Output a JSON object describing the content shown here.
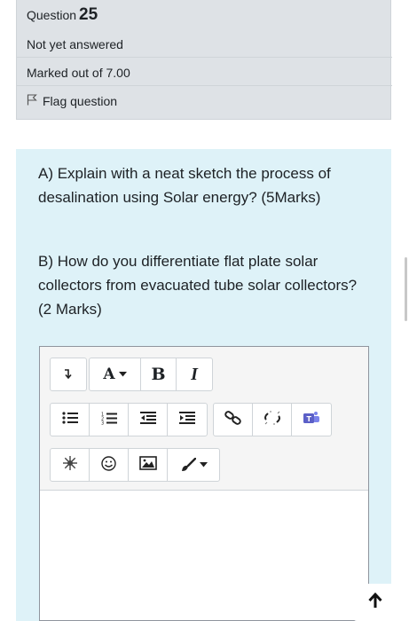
{
  "question": {
    "label": "Question",
    "number": "25",
    "status": "Not yet answered",
    "marks": "Marked out of 7.00",
    "flag_label": "Flag question"
  },
  "content": {
    "part_a": "A) Explain with a neat sketch the process of desalination using Solar energy? (5Marks)",
    "part_b": "B) How do you differentiate flat plate solar collectors from evacuated tube solar collectors? (2 Marks)"
  },
  "toolbar": {
    "bold_label": "B",
    "italic_label": "I",
    "font_color_label": "A",
    "icons": [
      "collapse-toggle-icon",
      "font-color-icon",
      "bold-icon",
      "italic-icon",
      "unordered-list-icon",
      "ordered-list-icon",
      "outdent-icon",
      "indent-icon",
      "link-icon",
      "unlink-icon",
      "teams-meeting-icon",
      "special-character-icon",
      "emoji-icon",
      "image-icon",
      "paint-brush-icon"
    ]
  },
  "colors": {
    "info_bg": "#dee2e6",
    "content_bg": "#def2f8",
    "teams_purple": "#5b5fc7"
  }
}
